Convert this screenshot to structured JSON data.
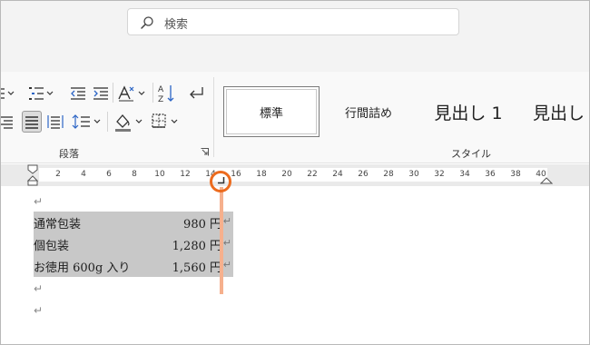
{
  "search": {
    "placeholder": "検索"
  },
  "ribbon": {
    "paragraph_group_label": "段落",
    "styles_group_label": "スタイル",
    "styles": [
      {
        "label": "標準",
        "selected": true
      },
      {
        "label": "行間詰め"
      },
      {
        "label": "見出し 1"
      },
      {
        "label": "見出し"
      }
    ]
  },
  "ruler": {
    "numbers": [
      "2",
      "4",
      "6",
      "8",
      "10",
      "12",
      "14",
      "16",
      "18",
      "20",
      "22",
      "24",
      "26",
      "28",
      "30",
      "32",
      "34",
      "36",
      "38",
      "40"
    ]
  },
  "document": {
    "rows": [
      {
        "item": "通常包装",
        "price": "980 円"
      },
      {
        "item": "個包装",
        "price": "1,280 円"
      },
      {
        "item": "お徳用 600g 入り",
        "price": "1,560 円"
      }
    ],
    "paragraph_mark": "↵"
  },
  "colors": {
    "highlight": "#ec6b1e",
    "guide": "#f6b08d",
    "selection": "#c8c8c8"
  }
}
